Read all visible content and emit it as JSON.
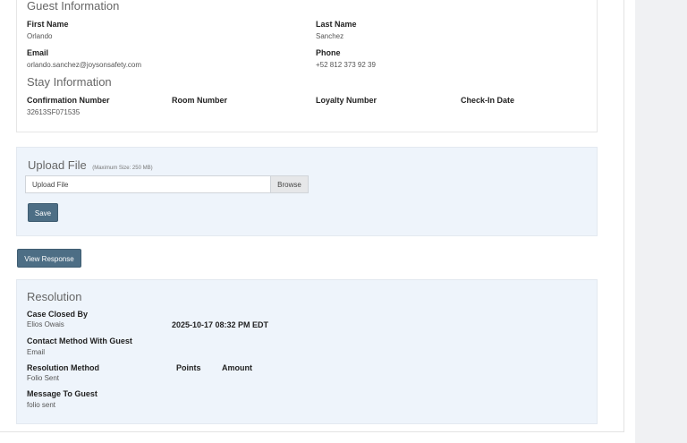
{
  "guest_information": {
    "title": "Guest Information",
    "first_name_label": "First Name",
    "first_name": "Orlando",
    "last_name_label": "Last Name",
    "last_name": "Sanchez",
    "email_label": "Email",
    "email": "orlando.sanchez@joysonsafety.com",
    "phone_label": "Phone",
    "phone": "+52 812 373 92 39"
  },
  "stay_information": {
    "title": "Stay Information",
    "confirmation_label": "Confirmation Number",
    "confirmation": "32613SF071535",
    "room_label": "Room Number",
    "loyalty_label": "Loyalty Number",
    "checkin_label": "Check-In Date"
  },
  "upload": {
    "title": "Upload File",
    "note": "(Maximum Size: 250 MB)",
    "input_placeholder": "Upload File",
    "browse_label": "Browse",
    "save_label": "Save"
  },
  "view_response_label": "View Response",
  "resolution": {
    "title": "Resolution",
    "case_closed_label": "Case Closed By",
    "case_closed_by": "Elios Owais",
    "closed_datetime": "2025-10-17 08:32 PM EDT",
    "contact_method_label": "Contact Method With Guest",
    "contact_method": "Email",
    "resolution_method_label": "Resolution Method",
    "resolution_method": "Folio Sent",
    "points_label": "Points",
    "amount_label": "Amount",
    "message_label": "Message To Guest",
    "message": "folio sent"
  }
}
